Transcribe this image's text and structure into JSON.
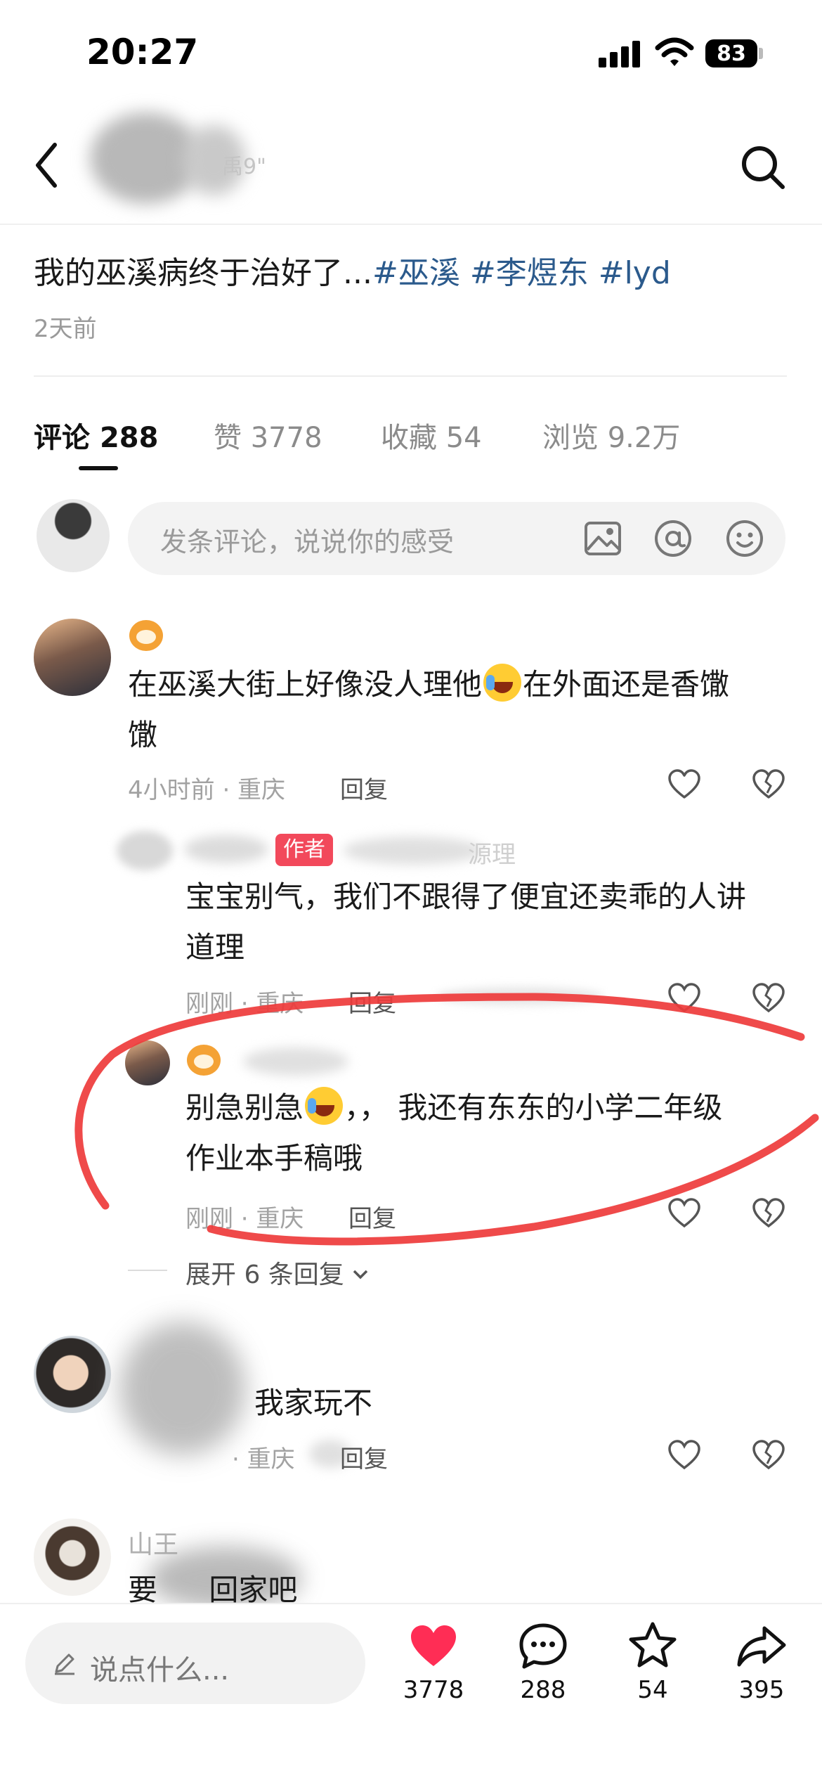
{
  "status_bar": {
    "time": "20:27",
    "battery": "83"
  },
  "header": {
    "partial_username": "禹9\""
  },
  "post": {
    "title_text": "我的巫溪病终于治好了...",
    "tags": [
      "#巫溪",
      "#李煜东",
      "#lyd"
    ],
    "time": "2天前"
  },
  "tabs": [
    {
      "label": "评论",
      "count": "288"
    },
    {
      "label": "赞",
      "count": "3778"
    },
    {
      "label": "收藏",
      "count": "54"
    },
    {
      "label": "浏览",
      "count": "9.2万"
    }
  ],
  "comment_input": {
    "placeholder": "发条评论，说说你的感受"
  },
  "comments": [
    {
      "text_a": "在巫溪大街上好像没人理他",
      "text_b": "在外面还是香馓",
      "text_c": "馓",
      "meta": "4小时前 · 重庆",
      "reply_label": "回复"
    },
    {
      "badge": "作者",
      "name_partial": "源理",
      "text_a": "宝宝别气，我们不跟得了便宜还卖乖的人讲",
      "text_b": "道理",
      "meta": "刚刚 · 重庆",
      "reply_label": "回复"
    },
    {
      "text_a": "别急别急",
      "text_b": "，， 我还有东东的小学二年级",
      "text_c": "作业本手稿哦",
      "meta": "刚刚 · 重庆",
      "reply_label": "回复"
    },
    {
      "text_a": "我家玩不",
      "meta": "· 重庆",
      "reply_label": "回复"
    },
    {
      "name_partial": "山王",
      "text_a": "要",
      "text_b": "回家吧"
    }
  ],
  "expand_replies": "展开 6 条回复",
  "bottom_bar": {
    "say_placeholder": "说点什么...",
    "likes": "3778",
    "comments": "288",
    "favorites": "54",
    "shares": "395"
  },
  "colors": {
    "like_red": "#ff2d55",
    "annotation_red": "#ee3b3b",
    "tag_blue": "#2b5a8c"
  }
}
